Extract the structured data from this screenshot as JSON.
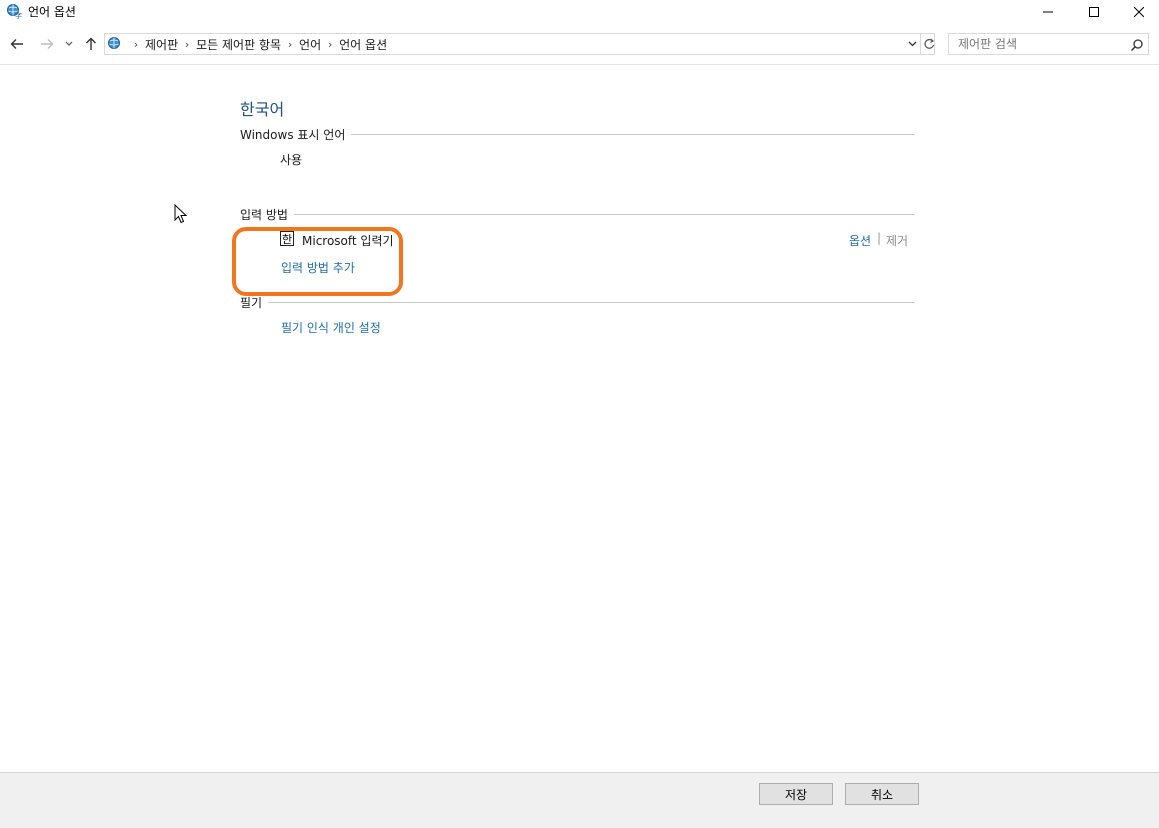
{
  "window": {
    "title": "언어 옵션",
    "icon": "language-globe-icon"
  },
  "navigation": {
    "back": "back-arrow-icon",
    "forward": "forward-arrow-icon",
    "recent": "chevron-down-icon",
    "up": "up-arrow-icon"
  },
  "address": {
    "breadcrumbs": [
      "제어판",
      "모든 제어판 항목",
      "언어",
      "언어 옵션"
    ]
  },
  "search": {
    "placeholder": "제어판 검색"
  },
  "language": {
    "title": "한국어",
    "display_section": {
      "label": "Windows 표시 언어",
      "status": "사용"
    },
    "input_section": {
      "label": "입력 방법",
      "ime_badge": "한",
      "ime_name": "Microsoft 입력기",
      "options_link": "옵션",
      "separator": "|",
      "remove_link": "제거",
      "add_link": "입력 방법 추가"
    },
    "handwriting_section": {
      "label": "필기",
      "personalize_link": "필기 인식 개인 설정"
    }
  },
  "footer": {
    "save_label": "저장",
    "cancel_label": "취소"
  },
  "colors": {
    "link": "#1a6fb5",
    "title": "#1e4f88",
    "highlight": "#f2761e"
  }
}
